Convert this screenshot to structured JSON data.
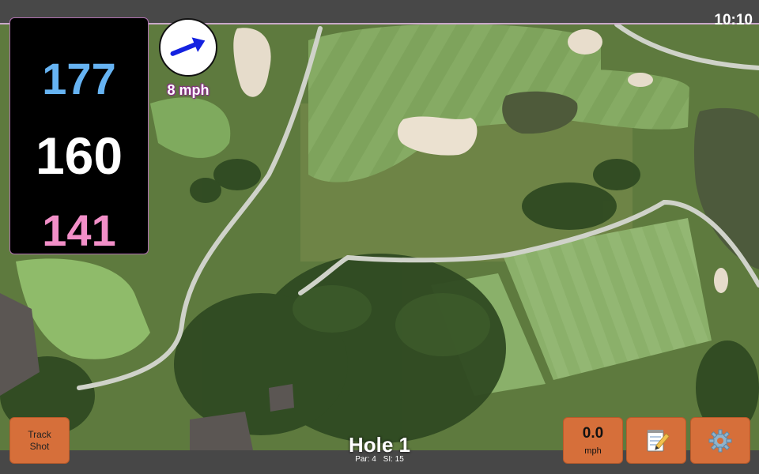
{
  "status": {
    "time": "10:10"
  },
  "distances": {
    "back": "177",
    "middle": "160",
    "front": "141"
  },
  "wind": {
    "speed_label": "8 mph",
    "direction_icon": "wind-arrow-icon"
  },
  "hole": {
    "title": "Hole 1",
    "par_label": "Par: 4",
    "si_label": "SI: 15"
  },
  "buttons": {
    "track_shot_line1": "Track",
    "track_shot_line2": "Shot",
    "speed_value": "0.0",
    "speed_unit": "mph",
    "notes_icon": "notepad-icon",
    "settings_icon": "gear-icon"
  },
  "colors": {
    "back_distance": "#66b3f2",
    "middle_distance": "#ffffff",
    "front_distance": "#f28fc8",
    "button_orange": "#d66f3a",
    "wind_label_outline": "#8a2a8a"
  }
}
